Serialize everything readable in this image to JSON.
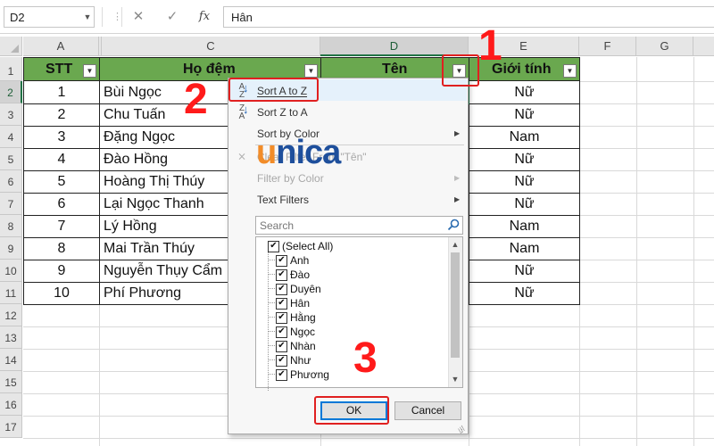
{
  "formula_bar": {
    "name_box": "D2",
    "cancel_glyph": "✕",
    "enter_glyph": "✓",
    "fx_label": "fx",
    "formula_value": "Hân"
  },
  "columns": [
    "A",
    "C",
    "D",
    "E",
    "F",
    "G"
  ],
  "row_numbers": [
    "1",
    "2",
    "3",
    "4",
    "5",
    "6",
    "7",
    "8",
    "9",
    "10",
    "11",
    "12",
    "13",
    "14",
    "15",
    "16",
    "17"
  ],
  "table": {
    "headers": [
      "STT",
      "Họ đệm",
      "Tên",
      "Giới tính"
    ],
    "rows": [
      {
        "stt": "1",
        "ho_dem": "Bùi Ngọc",
        "gioi_tinh": "Nữ"
      },
      {
        "stt": "2",
        "ho_dem": "Chu Tuấn",
        "gioi_tinh": "Nữ"
      },
      {
        "stt": "3",
        "ho_dem": "Đặng Ngọc",
        "gioi_tinh": "Nam"
      },
      {
        "stt": "4",
        "ho_dem": "Đào Hồng",
        "gioi_tinh": "Nữ"
      },
      {
        "stt": "5",
        "ho_dem": "Hoàng Thị Thúy",
        "gioi_tinh": "Nữ"
      },
      {
        "stt": "6",
        "ho_dem": "Lại Ngọc Thanh",
        "gioi_tinh": "Nữ"
      },
      {
        "stt": "7",
        "ho_dem": "Lý Hồng",
        "gioi_tinh": "Nam"
      },
      {
        "stt": "8",
        "ho_dem": "Mai Trần Thúy",
        "gioi_tinh": "Nam"
      },
      {
        "stt": "9",
        "ho_dem": "Nguyễn Thụy Cẩm",
        "gioi_tinh": "Nữ"
      },
      {
        "stt": "10",
        "ho_dem": "Phí Phương",
        "gioi_tinh": "Nữ"
      }
    ]
  },
  "filter_menu": {
    "sort_a_z": "Sort A to Z",
    "sort_z_a": "Sort Z to A",
    "sort_by_color": "Sort by Color",
    "clear_filter": "Clear Filter From \"Tên\"",
    "filter_by_color": "Filter by Color",
    "text_filters": "Text Filters",
    "search_placeholder": "Search",
    "items": [
      "(Select All)",
      "Anh",
      "Đào",
      "Duyên",
      "Hân",
      "Hằng",
      "Ngọc",
      "Nhàn",
      "Như",
      "Phương"
    ],
    "ok_label": "OK",
    "cancel_label": "Cancel"
  },
  "annotations": {
    "step1": "1",
    "step2": "2",
    "step3": "3",
    "highlight_color": "#e02020"
  },
  "watermark": {
    "letters": [
      "u",
      "n",
      "i",
      "c",
      "a"
    ],
    "colors": [
      "#f28c28",
      "#1e4f9c",
      "#1e4f9c",
      "#1e4f9c",
      "#1e4f9c"
    ]
  },
  "colors": {
    "header_fill": "#6aa84f",
    "excel_green": "#217346",
    "annotation_red": "#ff1a1a"
  }
}
